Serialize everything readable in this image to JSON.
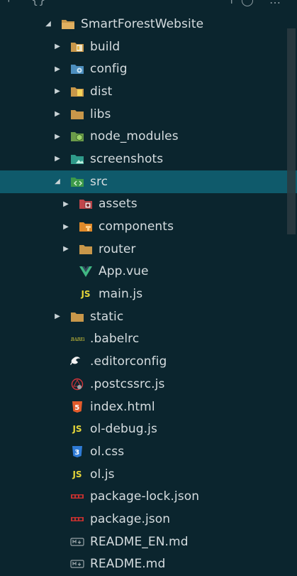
{
  "colors": {
    "background": "#0b252e",
    "selection": "#0f5a6b",
    "text": "#d6dde0",
    "folder": "#c8974a",
    "js": "#e6d63a",
    "html": "#e35b2b",
    "css": "#2f7bd6",
    "vue": "#41b883",
    "npm": "#c3302f",
    "md": "#9aa5a9"
  },
  "topbar": {
    "fragment_icon_names": [
      "collapse-icon",
      "code-icon",
      "arrow-icon",
      "refresh-icon",
      "more-icon"
    ]
  },
  "tree": {
    "root": {
      "label": "SmartForestWebsite",
      "state": "expanded",
      "icon": "folder-open-icon"
    },
    "items": [
      {
        "label": "build",
        "type": "folder",
        "icon": "folder-build-icon"
      },
      {
        "label": "config",
        "type": "folder",
        "icon": "folder-config-icon"
      },
      {
        "label": "dist",
        "type": "folder",
        "icon": "folder-dist-icon"
      },
      {
        "label": "libs",
        "type": "folder",
        "icon": "folder-icon"
      },
      {
        "label": "node_modules",
        "type": "folder",
        "icon": "folder-node-icon"
      },
      {
        "label": "screenshots",
        "type": "folder",
        "icon": "folder-images-icon"
      },
      {
        "label": "src",
        "type": "folder",
        "state": "expanded",
        "selected": true,
        "icon": "folder-src-icon"
      },
      {
        "label": "assets",
        "type": "folder",
        "icon": "folder-assets-icon"
      },
      {
        "label": "components",
        "type": "folder",
        "icon": "folder-components-icon"
      },
      {
        "label": "router",
        "type": "folder",
        "icon": "folder-icon"
      },
      {
        "label": "App.vue",
        "type": "file",
        "icon": "vue-icon"
      },
      {
        "label": "main.js",
        "type": "file",
        "icon": "js-icon"
      },
      {
        "label": "static",
        "type": "folder",
        "icon": "folder-icon"
      },
      {
        "label": ".babelrc",
        "type": "file",
        "icon": "babel-icon"
      },
      {
        "label": ".editorconfig",
        "type": "file",
        "icon": "editorconfig-icon"
      },
      {
        "label": ".postcssrc.js",
        "type": "file",
        "icon": "postcss-icon"
      },
      {
        "label": "index.html",
        "type": "file",
        "icon": "html5-icon"
      },
      {
        "label": "ol-debug.js",
        "type": "file",
        "icon": "js-icon"
      },
      {
        "label": "ol.css",
        "type": "file",
        "icon": "css3-icon"
      },
      {
        "label": "ol.js",
        "type": "file",
        "icon": "js-icon"
      },
      {
        "label": "package-lock.json",
        "type": "file",
        "icon": "npm-icon"
      },
      {
        "label": "package.json",
        "type": "file",
        "icon": "npm-icon"
      },
      {
        "label": "README_EN.md",
        "type": "file",
        "icon": "markdown-icon"
      },
      {
        "label": "README.md",
        "type": "file",
        "icon": "markdown-icon"
      }
    ]
  }
}
